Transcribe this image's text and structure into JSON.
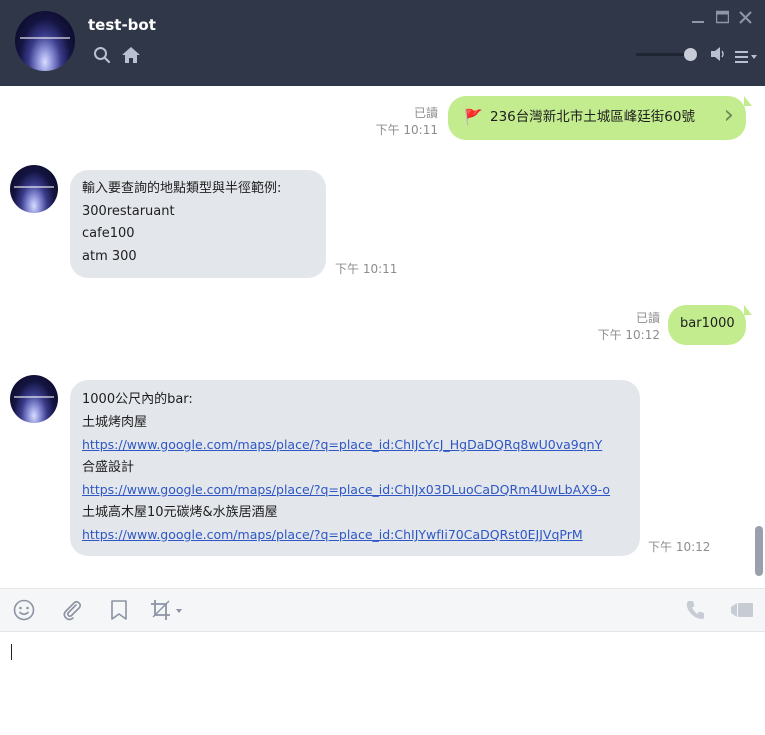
{
  "header": {
    "bot_name": "test-bot",
    "icons": [
      "search-icon",
      "home-icon",
      "minimize-icon",
      "maximize-icon",
      "close-icon",
      "volume-icon",
      "menu-icon"
    ]
  },
  "messages": {
    "m1": {
      "read": "已讀",
      "time": "下午 10:11",
      "flag": "🚩",
      "text": "236台灣新北市土城區峰廷街60號",
      "chevron": "›"
    },
    "m2": {
      "lines": [
        "輸入要查詢的地點類型與半徑範例:",
        "300restaruant",
        "cafe100",
        "atm 300"
      ],
      "time": "下午 10:11"
    },
    "m3": {
      "read": "已讀",
      "time": "下午 10:12",
      "text": "bar1000"
    },
    "m4": {
      "title": "1000公尺內的bar:",
      "places": [
        {
          "name": "土城烤肉屋",
          "url": "https://www.google.com/maps/place/?q=place_id:ChIJcYcJ_HgDaDQRq8wU0va9qnY"
        },
        {
          "name": "合盛設計",
          "url": "https://www.google.com/maps/place/?q=place_id:ChIJx03DLuoCaDQRm4UwLbAX9-o"
        },
        {
          "name": "土城高木屋10元碳烤&水族居酒屋",
          "url": "https://www.google.com/maps/place/?q=place_id:ChIJYwfIi70CaDQRst0EJJVqPrM"
        }
      ],
      "time": "下午 10:12"
    }
  },
  "toolbar": [
    "emoji-icon",
    "attach-icon",
    "bookmark-icon",
    "crop-icon",
    "phone-icon",
    "video-icon"
  ],
  "colors": {
    "header": "#2f3749",
    "outgoing": "#c3ec8f",
    "incoming": "#e3e6ea",
    "link": "#2e57c5"
  }
}
